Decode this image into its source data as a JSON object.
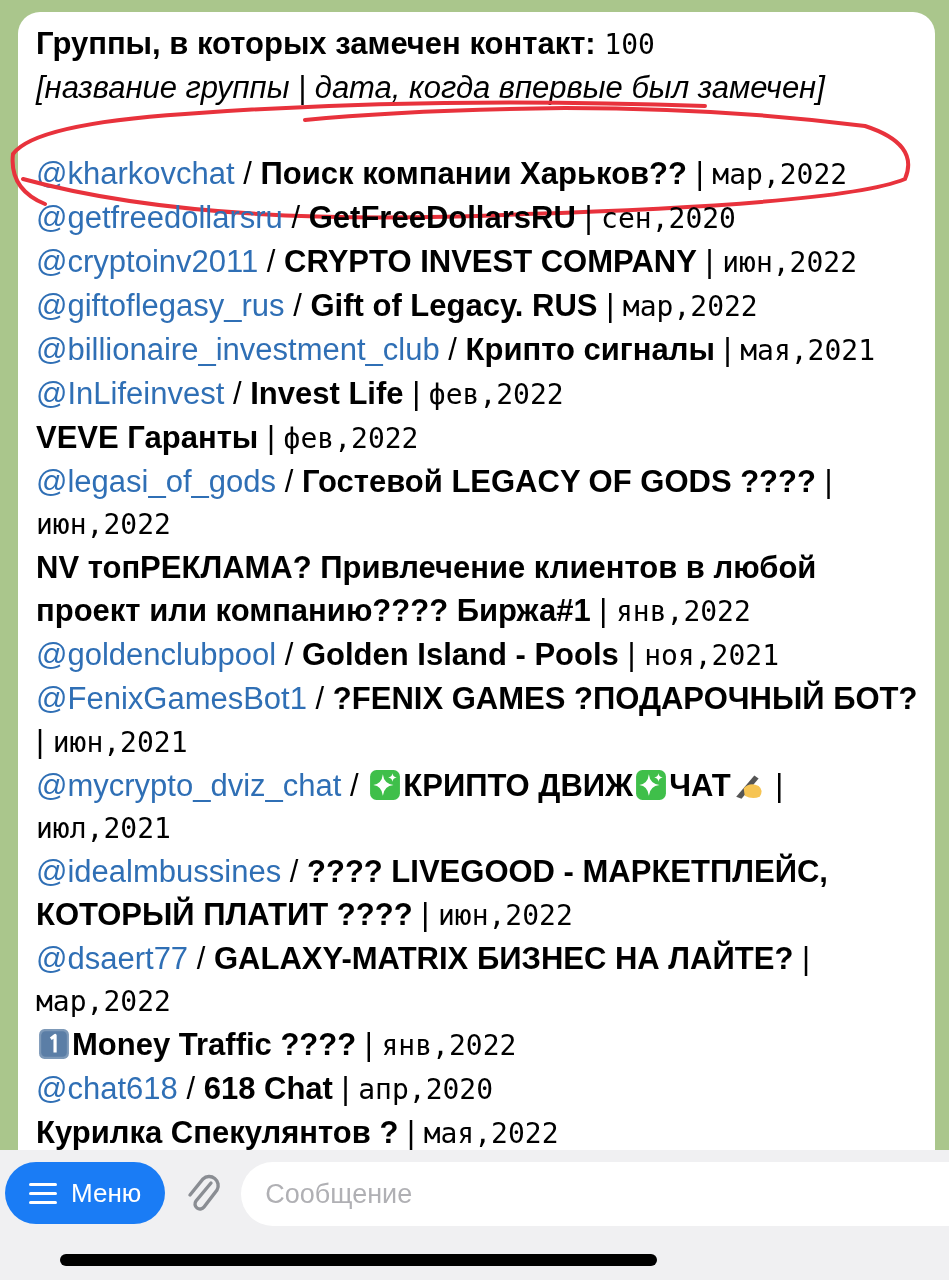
{
  "message": {
    "title": "Группы, в которых замечен контакт:",
    "count": "100",
    "legend": "[название группы | дата, когда впервые был замечен]",
    "entries": [
      {
        "handle": "@kharkovchat",
        "slash": "/",
        "name_parts": [
          {
            "kind": "text",
            "text": "Поиск компании Харьков??"
          }
        ],
        "bar": "|",
        "date": "мар,2022",
        "circled": true
      },
      {
        "handle": "@getfreedollarsru",
        "slash": "/",
        "name_parts": [
          {
            "kind": "text",
            "text": "GetFreeDollarsRU"
          }
        ],
        "bar": "|",
        "date": "сен,2020",
        "circled": false
      },
      {
        "handle": "@cryptoinv2011",
        "slash": "/",
        "name_parts": [
          {
            "kind": "text",
            "text": "CRYPTO INVEST COMPANY"
          }
        ],
        "bar": "|",
        "date": "июн,2022",
        "circled": false
      },
      {
        "handle": "@giftoflegasy_rus",
        "slash": "/",
        "name_parts": [
          {
            "kind": "text",
            "text": "Gift of Legacy. RUS"
          }
        ],
        "bar": "|",
        "date": "мар,2022",
        "circled": false
      },
      {
        "handle": "@billionaire_investment_club",
        "slash": "/",
        "name_parts": [
          {
            "kind": "text",
            "text": "Крипто сигналы"
          }
        ],
        "bar": "|",
        "date": "мая,2021",
        "circled": false
      },
      {
        "handle": "@InLifeinvest",
        "slash": "/",
        "name_parts": [
          {
            "kind": "text",
            "text": "Invest Life"
          }
        ],
        "bar": "|",
        "date": "фев,2022",
        "circled": false
      },
      {
        "name_parts": [
          {
            "kind": "text",
            "text": "VEVE Гаранты"
          }
        ],
        "bar": "|",
        "date": "фев,2022",
        "circled": false
      },
      {
        "handle": "@legasi_of_gods",
        "slash": "/",
        "name_parts": [
          {
            "kind": "text",
            "text": "Гостевой LEGACY OF GODS ????"
          }
        ],
        "bar": "|",
        "date": "июн,2022",
        "circled": false
      },
      {
        "name_parts": [
          {
            "kind": "text",
            "text": "NV топРЕКЛАМА? Привлечение клиентов в любой проект или компанию???? Биржа#1"
          }
        ],
        "bar": "|",
        "date": "янв,2022",
        "circled": false
      },
      {
        "handle": "@goldenclubpool",
        "slash": "/",
        "name_parts": [
          {
            "kind": "text",
            "text": "Golden Island - Pools"
          }
        ],
        "bar": "|",
        "date": "ноя,2021",
        "circled": false
      },
      {
        "handle": "@FenixGamesBot1",
        "slash": "/",
        "name_parts": [
          {
            "kind": "text",
            "text": "?FENIX GAMES ?ПОДАРОЧНЫЙ БОТ?"
          }
        ],
        "bar": "|",
        "date": "июн,2021",
        "circled": false
      },
      {
        "handle": "@mycrypto_dviz_chat",
        "slash": "/",
        "name_parts": [
          {
            "kind": "sparkle"
          },
          {
            "kind": "text",
            "text": "КРИПТО ДВИЖ"
          },
          {
            "kind": "sparkle"
          },
          {
            "kind": "text",
            "text": "ЧАТ"
          },
          {
            "kind": "hand"
          }
        ],
        "bar": "|",
        "date": "июл,2021",
        "circled": false
      },
      {
        "handle": "@idealmbussines",
        "slash": "/",
        "name_parts": [
          {
            "kind": "text",
            "text": "???? LIVEGOOD - МАРКЕТПЛЕЙС, КОТОРЫЙ ПЛАТИТ ????"
          }
        ],
        "bar": "|",
        "date": "июн,2022",
        "circled": false
      },
      {
        "handle": "@dsaert77",
        "slash": "/",
        "name_parts": [
          {
            "kind": "text",
            "text": "GALAXY-MATRIX БИЗНЕС НА ЛАЙТЕ?"
          }
        ],
        "bar": "|",
        "date": "мар,2022",
        "circled": false
      },
      {
        "name_parts": [
          {
            "kind": "keycap"
          },
          {
            "kind": "text",
            "text": "Money Traffic ????"
          }
        ],
        "bar": "|",
        "date": "янв,2022",
        "circled": false
      },
      {
        "handle": "@chat618",
        "slash": "/",
        "name_parts": [
          {
            "kind": "text",
            "text": "618 Chat"
          }
        ],
        "bar": "|",
        "date": "апр,2020",
        "circled": false
      },
      {
        "name_parts": [
          {
            "kind": "text",
            "text": "Курилка Спекулянтов ?"
          }
        ],
        "bar": "|",
        "date": "мая,2022",
        "circled": false
      }
    ]
  },
  "composer": {
    "menu_button": "Меню",
    "placeholder": "Сообщение"
  }
}
